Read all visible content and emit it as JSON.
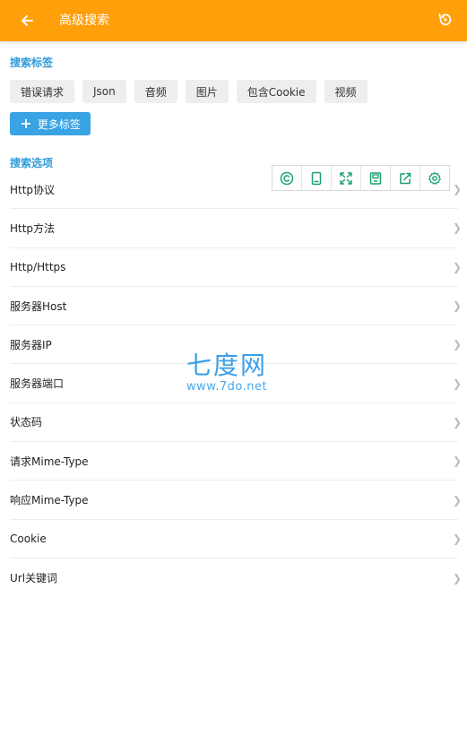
{
  "appbar": {
    "title": "高级搜索",
    "back_icon": "arrow-left-icon",
    "reset_icon": "reset-icon",
    "background": "#ff9f0a"
  },
  "tags_section": {
    "title": "搜索标签",
    "tags": [
      "错误请求",
      "Json",
      "音频",
      "图片",
      "包含Cookie",
      "视频"
    ],
    "more_label": "更多标签"
  },
  "options_section": {
    "title": "搜索选项",
    "items": [
      "Http协议",
      "Http方法",
      "Http/Https",
      "服务器Host",
      "服务器IP",
      "服务器端口",
      "状态码",
      "请求Mime-Type",
      "响应Mime-Type",
      "Cookie",
      "Url关键词"
    ]
  },
  "floating_toolbar": {
    "icons": [
      "copyright-icon",
      "tablet-icon",
      "expand-icon",
      "save-icon",
      "share-icon",
      "settings-icon"
    ],
    "color": "#1aa06d"
  },
  "watermark": {
    "big": "七度网",
    "small": "www.7do.net"
  },
  "colors": {
    "accent": "#2f9ad9",
    "button": "#39a3e3"
  }
}
